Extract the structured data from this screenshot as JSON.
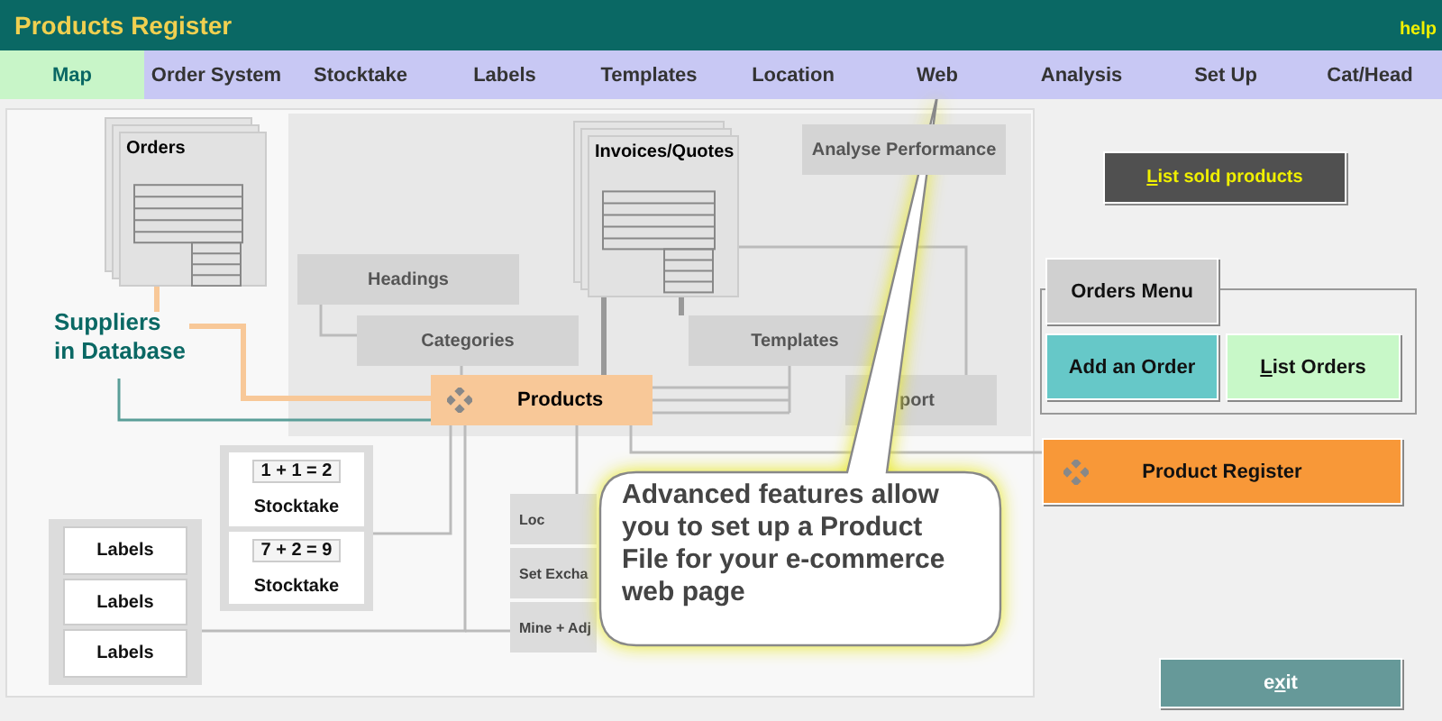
{
  "window": {
    "title": "Products Register",
    "help": "help"
  },
  "tabs": [
    {
      "label": "Map",
      "selected": true
    },
    {
      "label": "Order System",
      "selected": false
    },
    {
      "label": "Stocktake",
      "selected": false
    },
    {
      "label": "Labels",
      "selected": false
    },
    {
      "label": "Templates",
      "selected": false
    },
    {
      "label": "Location",
      "selected": false
    },
    {
      "label": "Web",
      "selected": false
    },
    {
      "label": "Analysis",
      "selected": false
    },
    {
      "label": "Set Up",
      "selected": false
    },
    {
      "label": "Cat/Head",
      "selected": false
    }
  ],
  "diagram": {
    "documents": [
      {
        "label": "Orders"
      },
      {
        "label": "Invoices/Quotes"
      }
    ],
    "boxes": [
      {
        "label": "Analyse Performance"
      },
      {
        "label": "Headings"
      },
      {
        "label": "Categories"
      },
      {
        "label": "Templates"
      },
      {
        "label": "port"
      }
    ],
    "products": {
      "label": "Products"
    },
    "suppliers": "Suppliers\nin Database",
    "stocktake": [
      {
        "sum": "1 + 1 = 2",
        "label": "Stocktake"
      },
      {
        "sum": "7 + 2 = 9",
        "label": "Stocktake"
      }
    ],
    "labels": [
      "Labels",
      "Labels",
      "Labels"
    ],
    "side_items": [
      "Loc",
      "Set Excha",
      "Mine + Adj"
    ]
  },
  "callout": "Advanced features allow you to set up a Product File for your e-commerce web page",
  "buttons": [
    {
      "kind": "list_sold",
      "parts": {
        "key": "L",
        "post": "ist sold products"
      }
    },
    {
      "kind": "orders_menu",
      "label": "Orders Menu"
    },
    {
      "kind": "add_order",
      "label": "Add an Order"
    },
    {
      "kind": "list_orders",
      "parts": {
        "key": "L",
        "post": "ist Orders"
      }
    },
    {
      "kind": "product_register",
      "label": "Product Register"
    },
    {
      "kind": "exit",
      "parts": {
        "pre": "e",
        "key": "x",
        "post": "it"
      }
    }
  ]
}
